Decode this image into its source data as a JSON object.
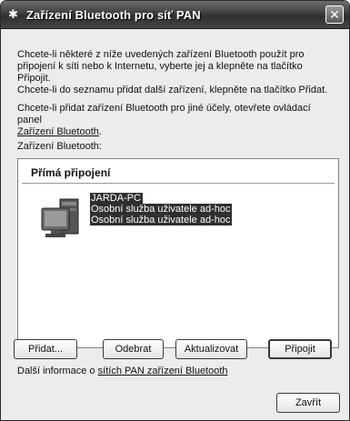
{
  "window": {
    "title": "Zařízení Bluetooth pro síť PAN",
    "close_glyph": "✕",
    "title_icon": "bluetooth-icon"
  },
  "intro": {
    "line1": "Chcete-li některé z níže uvedených zařízení Bluetooth použít pro",
    "line2": "připojení k síti nebo k Internetu, vyberte jej a klepněte na tlačítko Připojit.",
    "line3": "Chcete-li do seznamu přidat další zařízení, klepněte na tlačítko Přidat."
  },
  "other_purposes": {
    "line1": "Chcete-li přidat zařízení Bluetooth pro jiné účely, otevřete ovládací panel",
    "link": "Zařízení Bluetooth",
    "link_suffix": "."
  },
  "devices_label": "Zařízení Bluetooth:",
  "device_list": {
    "group_header": "Přímá připojení",
    "devices": [
      {
        "name": "JARDA-PC",
        "services": [
          "Osobní služba uživatele ad-hoc",
          "Osobní služba uživatele ad-hoc"
        ],
        "icon": "computer-icon"
      }
    ]
  },
  "buttons": {
    "add": "Přidat...",
    "remove": "Odebrat",
    "refresh": "Aktualizovat",
    "connect": "Připojit",
    "close": "Zavřít"
  },
  "more_info": {
    "prefix": "Další informace o ",
    "link": "sítích PAN zařízení Bluetooth"
  }
}
